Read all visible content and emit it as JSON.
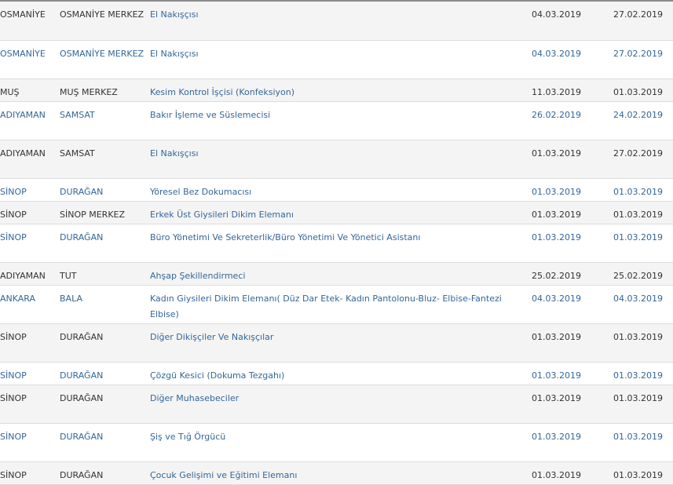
{
  "rows": [
    {
      "province": "OSMANİYE",
      "district": "OSMANİYE MERKEZ",
      "occupation": "El Nakışçısı",
      "date1": "04.03.2019",
      "date2": "27.02.2019",
      "height": 49,
      "link": false
    },
    {
      "province": "OSMANİYE",
      "district": "OSMANİYE MERKEZ",
      "occupation": "El Nakışçısı",
      "date1": "04.03.2019",
      "date2": "27.02.2019",
      "height": 49,
      "link": true
    },
    {
      "province": "MUŞ",
      "district": "MUŞ MERKEZ",
      "occupation": "Kesim Kontrol İşçisi (Konfeksiyon)",
      "date1": "11.03.2019",
      "date2": "01.03.2019",
      "height": 29,
      "link": false
    },
    {
      "province": "ADIYAMAN",
      "district": "SAMSAT",
      "occupation": "Bakır İşleme ve Süslemecisi",
      "date1": "26.02.2019",
      "date2": "24.02.2019",
      "height": 49,
      "link": true
    },
    {
      "province": "ADIYAMAN",
      "district": "SAMSAT",
      "occupation": "El Nakışçısı",
      "date1": "01.03.2019",
      "date2": "27.02.2019",
      "height": 49,
      "link": false
    },
    {
      "province": "SİNOP",
      "district": "DURAĞAN",
      "occupation": "Yöresel Bez Dokumacısı",
      "date1": "01.03.2019",
      "date2": "01.03.2019",
      "height": 29,
      "link": true
    },
    {
      "province": "SİNOP",
      "district": "SİNOP MERKEZ",
      "occupation": "Erkek Üst Giysileri Dikim Elemanı",
      "date1": "01.03.2019",
      "date2": "01.03.2019",
      "height": 29,
      "link": false
    },
    {
      "province": "SİNOP",
      "district": "DURAĞAN",
      "occupation": "Büro Yönetimi Ve Sekreterlik/Büro Yönetimi Ve Yönetici Asistanı",
      "date1": "01.03.2019",
      "date2": "01.03.2019",
      "height": 49,
      "link": true
    },
    {
      "province": "ADIYAMAN",
      "district": "TUT",
      "occupation": "Ahşap Şekillendirmeci",
      "date1": "25.02.2019",
      "date2": "25.02.2019",
      "height": 29,
      "link": false
    },
    {
      "province": "ANKARA",
      "district": "BALA",
      "occupation": "Kadın Giysileri Dikim Elemanı( Düz Dar Etek- Kadın Pantolonu-Bluz- Elbise-Fantezi Elbise)",
      "date1": "04.03.2019",
      "date2": "04.03.2019",
      "height": 49,
      "link": true
    },
    {
      "province": "SİNOP",
      "district": "DURAĞAN",
      "occupation": "Diğer Dikişçiler Ve Nakışçılar",
      "date1": "01.03.2019",
      "date2": "01.03.2019",
      "height": 49,
      "link": false
    },
    {
      "province": "SİNOP",
      "district": "DURAĞAN",
      "occupation": "Çözgü Kesici (Dokuma Tezgahı)",
      "date1": "01.03.2019",
      "date2": "01.03.2019",
      "height": 29,
      "link": true
    },
    {
      "province": "SİNOP",
      "district": "DURAĞAN",
      "occupation": "Diğer Muhasebeciler",
      "date1": "01.03.2019",
      "date2": "01.03.2019",
      "height": 49,
      "link": false
    },
    {
      "province": "SİNOP",
      "district": "DURAĞAN",
      "occupation": "Şiş ve Tığ Örgücü",
      "date1": "01.03.2019",
      "date2": "01.03.2019",
      "height": 49,
      "link": true
    },
    {
      "province": "SİNOP",
      "district": "DURAĞAN",
      "occupation": "Çocuk Gelişimi ve Eğitimi Elemanı",
      "date1": "01.03.2019",
      "date2": "01.03.2019",
      "height": 29,
      "link": false
    }
  ],
  "colors": {
    "link_text": "#336699",
    "plain_text": "#333333",
    "odd_row_bg": "#f4f4f4",
    "even_row_bg": "#ffffff",
    "row_border": "#dcdcdc"
  }
}
